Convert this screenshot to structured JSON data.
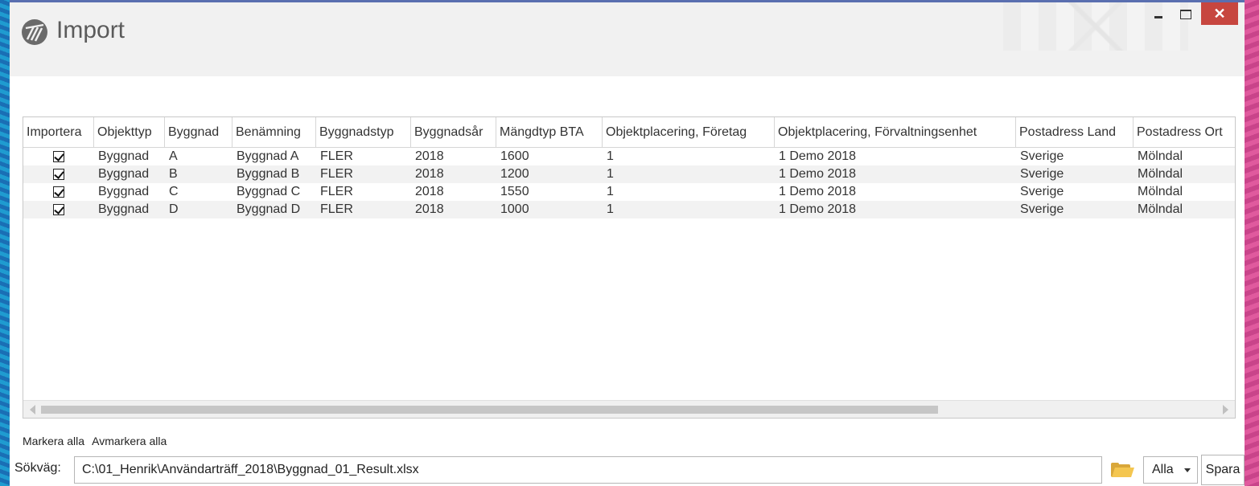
{
  "window": {
    "title": "Import",
    "close_label": "✕"
  },
  "grid": {
    "columns": [
      "Importera",
      "Objekttyp",
      "Byggnad",
      "Benämning",
      "Byggnadstyp",
      "Byggnadsår",
      "Mängdtyp BTA",
      "Objektplacering, Företag",
      "Objektplacering, Förvaltningsenhet",
      "Postadress Land",
      "Postadress Ort"
    ],
    "rows": [
      {
        "checked": true,
        "cells": [
          "Byggnad",
          "A",
          "Byggnad A",
          "FLER",
          "2018",
          "1600",
          "1",
          "1 Demo 2018",
          "Sverige",
          "Mölndal"
        ]
      },
      {
        "checked": true,
        "cells": [
          "Byggnad",
          "B",
          "Byggnad B",
          "FLER",
          "2018",
          "1200",
          "1",
          "1 Demo 2018",
          "Sverige",
          "Mölndal"
        ]
      },
      {
        "checked": true,
        "cells": [
          "Byggnad",
          "C",
          "Byggnad C",
          "FLER",
          "2018",
          "1550",
          "1",
          "1 Demo 2018",
          "Sverige",
          "Mölndal"
        ]
      },
      {
        "checked": true,
        "cells": [
          "Byggnad",
          "D",
          "Byggnad D",
          "FLER",
          "2018",
          "1000",
          "1",
          "1 Demo 2018",
          "Sverige",
          "Mölndal"
        ]
      }
    ]
  },
  "actions": {
    "select_all": "Markera alla",
    "deselect_all": "Avmarkera alla"
  },
  "path": {
    "label": "Sökväg:",
    "value": "C:\\01_Henrik\\Användarträff_2018\\Byggnad_01_Result.xlsx",
    "filter_selected": "Alla",
    "save_label": "Spara"
  },
  "colors": {
    "close_button": "#c7463f",
    "title_text": "#5b5b5b",
    "folder": "#f4c650"
  }
}
